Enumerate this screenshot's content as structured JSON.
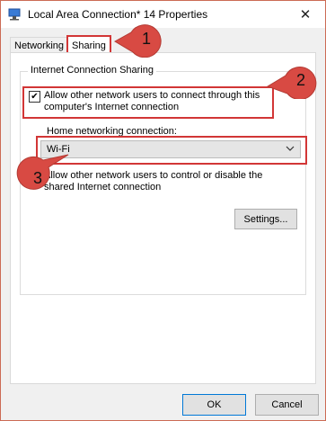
{
  "window": {
    "title": "Local Area Connection* 14 Properties",
    "close_symbol": "✕"
  },
  "tabs": [
    {
      "label": "Networking"
    },
    {
      "label": "Sharing"
    }
  ],
  "group": {
    "legend": "Internet Connection Sharing",
    "allow_connect": {
      "label_line1": "Allow other network users to connect through this",
      "label_line2": "computer's Internet connection",
      "checked": true
    },
    "home_networking": {
      "label": "Home networking connection:",
      "value": "Wi-Fi"
    },
    "allow_control": {
      "label_line1": "Allow other network users to control or disable the",
      "label_line2": "shared Internet connection",
      "checked": false
    },
    "settings_label": "Settings..."
  },
  "footer": {
    "ok_label": "OK",
    "cancel_label": "Cancel"
  },
  "callouts": [
    "1",
    "2",
    "3"
  ],
  "colors": {
    "highlight": "#d23636",
    "callout_fill": "#d84a43"
  }
}
